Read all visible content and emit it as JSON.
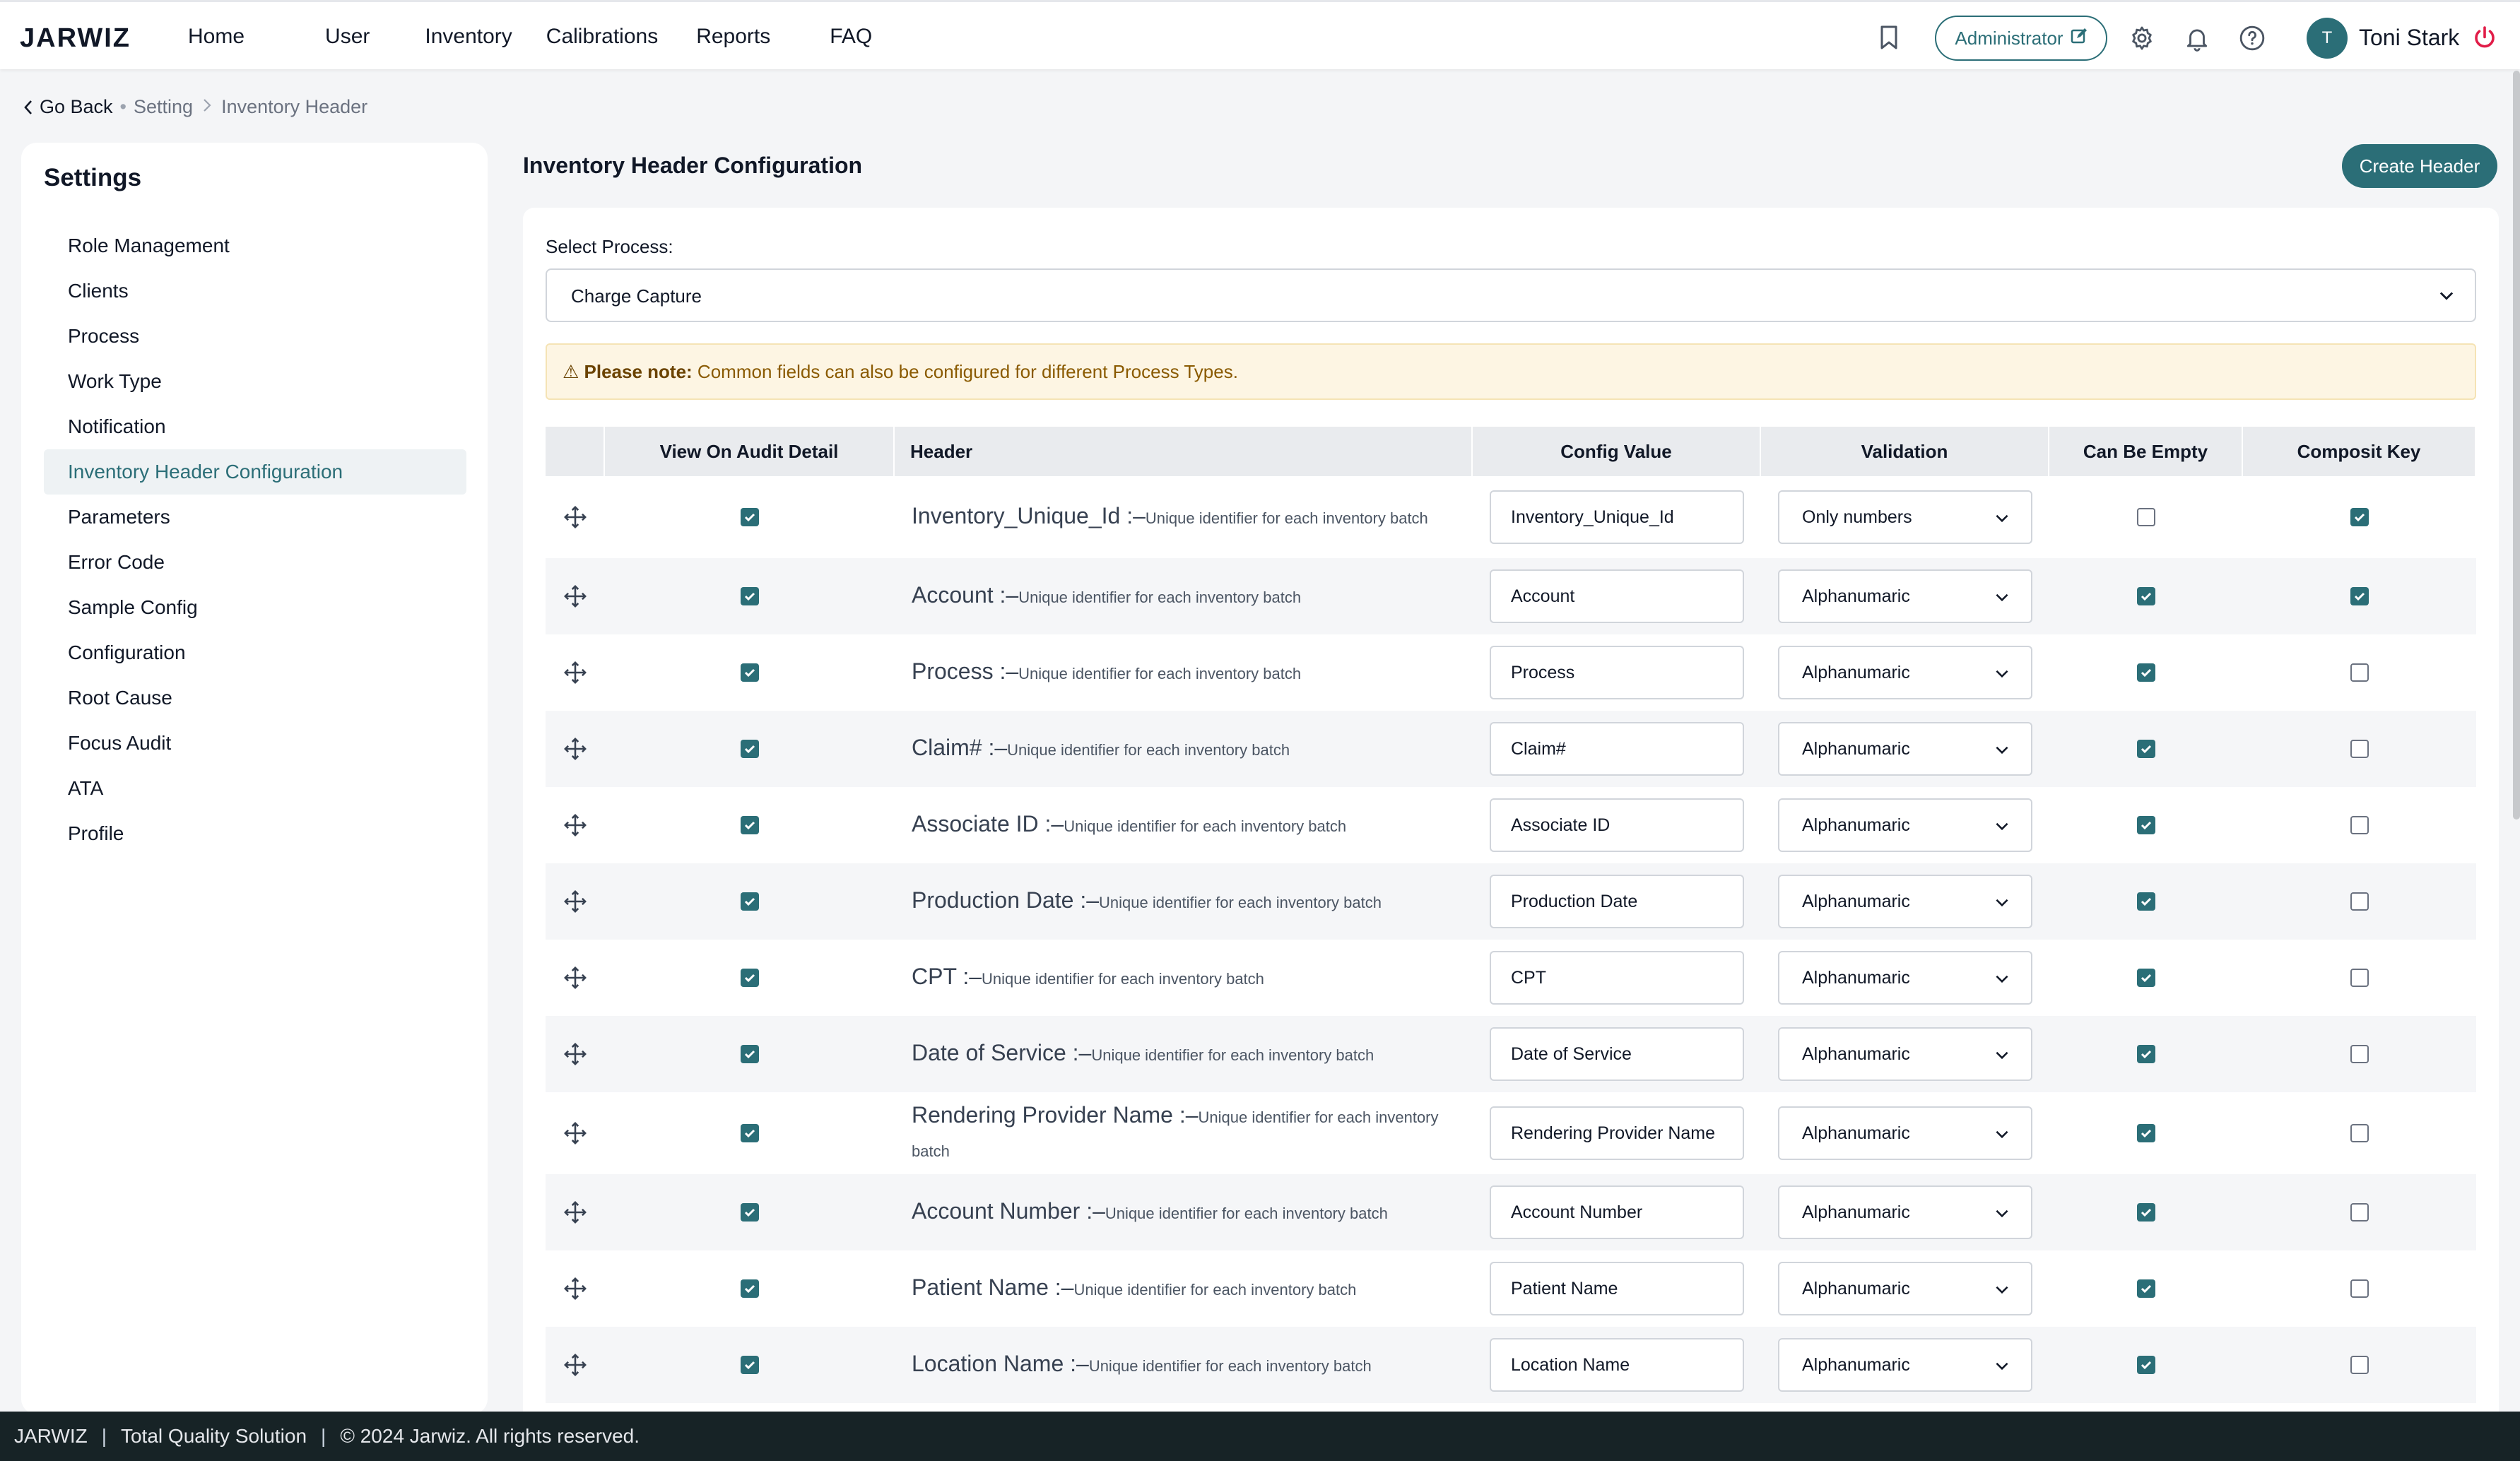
{
  "brand": {
    "logo": "JARWIZ"
  },
  "nav": {
    "items": [
      "Home",
      "User",
      "Inventory",
      "Calibrations",
      "Reports",
      "FAQ"
    ],
    "role_badge": "Administrator",
    "user": {
      "initial": "T",
      "name": "Toni Stark"
    },
    "icons": [
      "bookmark-icon",
      "edit-icon",
      "gear-icon",
      "bell-icon",
      "help-icon",
      "power-icon"
    ]
  },
  "breadcrumb": {
    "back": "Go Back",
    "parent": "Setting",
    "current": "Inventory Header"
  },
  "sidebar": {
    "title": "Settings",
    "items": [
      {
        "label": "Role Management",
        "active": false
      },
      {
        "label": "Clients",
        "active": false
      },
      {
        "label": "Process",
        "active": false
      },
      {
        "label": "Work Type",
        "active": false
      },
      {
        "label": "Notification",
        "active": false
      },
      {
        "label": "Inventory Header Configuration",
        "active": true
      },
      {
        "label": "Parameters",
        "active": false
      },
      {
        "label": "Error Code",
        "active": false
      },
      {
        "label": "Sample Config",
        "active": false
      },
      {
        "label": "Configuration",
        "active": false
      },
      {
        "label": "Root Cause",
        "active": false
      },
      {
        "label": "Focus Audit",
        "active": false
      },
      {
        "label": "ATA",
        "active": false
      },
      {
        "label": "Profile",
        "active": false
      }
    ]
  },
  "main": {
    "title": "Inventory Header Configuration",
    "create_button": "Create Header",
    "process_label": "Select Process:",
    "process_value": "Charge Capture",
    "note_prefix": "⚠ Please note:",
    "note_text": " Common fields can also be configured for different Process Types."
  },
  "table": {
    "columns": [
      "",
      "View On Audit Detail",
      "Header",
      "Config Value",
      "Validation",
      "Can Be Empty",
      "Composit Key"
    ],
    "rows": [
      {
        "name": "Inventory_Unique_Id",
        "desc": "Unique identifier for each inventory batch",
        "view": true,
        "config": "Inventory_Unique_Id",
        "validation": "Only numbers",
        "empty": false,
        "key": true
      },
      {
        "name": "Account",
        "desc": "Unique identifier for each inventory batch",
        "view": true,
        "config": "Account",
        "validation": "Alphanumaric",
        "empty": true,
        "key": true
      },
      {
        "name": "Process",
        "desc": "Unique identifier for each inventory batch",
        "view": true,
        "config": "Process",
        "validation": "Alphanumaric",
        "empty": true,
        "key": false
      },
      {
        "name": "Claim#",
        "desc": "Unique identifier for each inventory batch",
        "view": true,
        "config": "Claim#",
        "validation": "Alphanumaric",
        "empty": true,
        "key": false
      },
      {
        "name": "Associate ID",
        "desc": "Unique identifier for each inventory batch",
        "view": true,
        "config": "Associate ID",
        "validation": "Alphanumaric",
        "empty": true,
        "key": false
      },
      {
        "name": "Production Date",
        "desc": "Unique identifier for each inventory batch",
        "view": true,
        "config": "Production Date",
        "validation": "Alphanumaric",
        "empty": true,
        "key": false
      },
      {
        "name": "CPT",
        "desc": "Unique identifier for each inventory batch",
        "view": true,
        "config": "CPT",
        "validation": "Alphanumaric",
        "empty": true,
        "key": false
      },
      {
        "name": "Date of Service",
        "desc": "Unique identifier for each inventory batch",
        "view": true,
        "config": "Date of Service",
        "validation": "Alphanumaric",
        "empty": true,
        "key": false
      },
      {
        "name": "Rendering Provider Name",
        "desc": "Unique identifier for each inventory batch",
        "view": true,
        "config": "Rendering Provider Name",
        "validation": "Alphanumaric",
        "empty": true,
        "key": false
      },
      {
        "name": "Account Number",
        "desc": "Unique identifier for each inventory batch",
        "view": true,
        "config": "Account Number",
        "validation": "Alphanumaric",
        "empty": true,
        "key": false
      },
      {
        "name": "Patient Name",
        "desc": "Unique identifier for each inventory batch",
        "view": true,
        "config": "Patient Name",
        "validation": "Alphanumaric",
        "empty": true,
        "key": false
      },
      {
        "name": "Location Name",
        "desc": "Unique identifier for each inventory batch",
        "view": true,
        "config": "Location Name",
        "validation": "Alphanumaric",
        "empty": true,
        "key": false
      }
    ]
  },
  "footer": {
    "brand": "JARWIZ",
    "tagline": "Total Quality Solution",
    "copyright": "© 2024 Jarwiz. All rights reserved."
  },
  "colors": {
    "accent": "#2b6e77",
    "footer_bg": "#172326",
    "note_bg": "#fdf5e3"
  }
}
